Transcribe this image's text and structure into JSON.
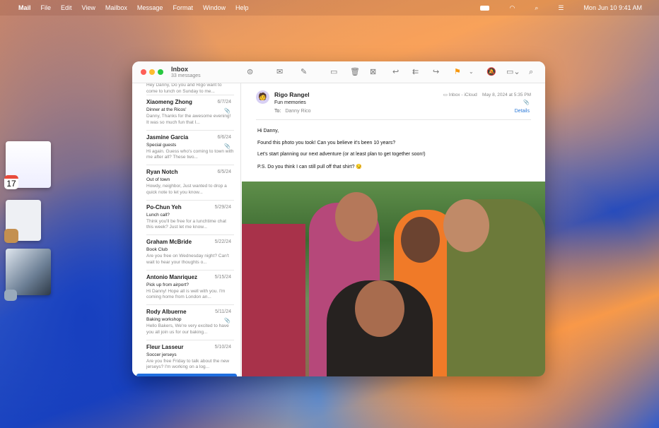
{
  "menubar": {
    "apple": "",
    "app": "Mail",
    "items": [
      "File",
      "Edit",
      "View",
      "Mailbox",
      "Message",
      "Format",
      "Window",
      "Help"
    ],
    "clock": "Mon Jun 10  9:41 AM",
    "icons": [
      "battery-icon",
      "wifi-icon",
      "search-icon",
      "control-center-icon"
    ]
  },
  "stage": {
    "calendar_date": "17"
  },
  "mailbox": {
    "title": "Inbox",
    "count": "33 messages"
  },
  "toolbar": {
    "icons": [
      "filter-icon",
      "new-message-icon",
      "compose-icon",
      "archive-icon",
      "trash-icon",
      "junk-icon",
      "reply-icon",
      "reply-all-icon",
      "forward-icon",
      "flag-icon",
      "chevron-down-icon",
      "mute-icon",
      "move-folder-icon",
      "search-icon"
    ],
    "flag_color": "#f7980f"
  },
  "list": {
    "partial": {
      "preview": "Hey Danny, Do you and Rigo want to come to lunch on Sunday to me..."
    },
    "items": [
      {
        "name": "Xiaomeng Zhong",
        "date": "6/7/24",
        "subject": "Dinner at the Ricos'",
        "preview": "Danny, Thanks for the awesome evening! It was so much fun that I...",
        "attachment": true
      },
      {
        "name": "Jasmine Garcia",
        "date": "6/6/24",
        "subject": "Special guests",
        "preview": "Hi again. Guess who's coming to town with me after all? These two...",
        "attachment": true
      },
      {
        "name": "Ryan Notch",
        "date": "6/5/24",
        "subject": "Out of town",
        "preview": "Howdy, neighbor, Just wanted to drop a quick note to let you know...",
        "attachment": false
      },
      {
        "name": "Po-Chun Yeh",
        "date": "5/29/24",
        "subject": "Lunch call?",
        "preview": "Think you'll be free for a lunchtime chat this week? Just let me know...",
        "attachment": false
      },
      {
        "name": "Graham McBride",
        "date": "5/22/24",
        "subject": "Book Club",
        "preview": "Are you free on Wednesday night? Can't wait to hear your thoughts o...",
        "attachment": false
      },
      {
        "name": "Antonio Manriquez",
        "date": "5/15/24",
        "subject": "Pick up from airport?",
        "preview": "Hi Danny! Hope all is well with you. I'm coming home from London an...",
        "attachment": false
      },
      {
        "name": "Rody Albuerne",
        "date": "5/11/24",
        "subject": "Baking workshop",
        "preview": "Hello Bakers, We're very excited to have you all join us for our baking...",
        "attachment": true
      },
      {
        "name": "Fleur Lasseur",
        "date": "5/10/24",
        "subject": "Soccer jerseys",
        "preview": "Are you free Friday to talk about the new jerseys? I'm working on a log...",
        "attachment": false
      }
    ]
  },
  "message": {
    "from": "Rigo Rangel",
    "subject": "Fun memories",
    "to_label": "To:",
    "to": "Danny Rico",
    "mailbox": "Inbox - iCloud",
    "date": "May 8, 2024 at 5:35 PM",
    "details": "Details",
    "body": [
      "Hi Danny,",
      "Found this photo you took! Can you believe it's been 10 years?",
      "Let's start planning our next adventure (or at least plan to get together soon!)",
      "P.S. Do you think I can still pull off that shirt? 😏"
    ]
  }
}
